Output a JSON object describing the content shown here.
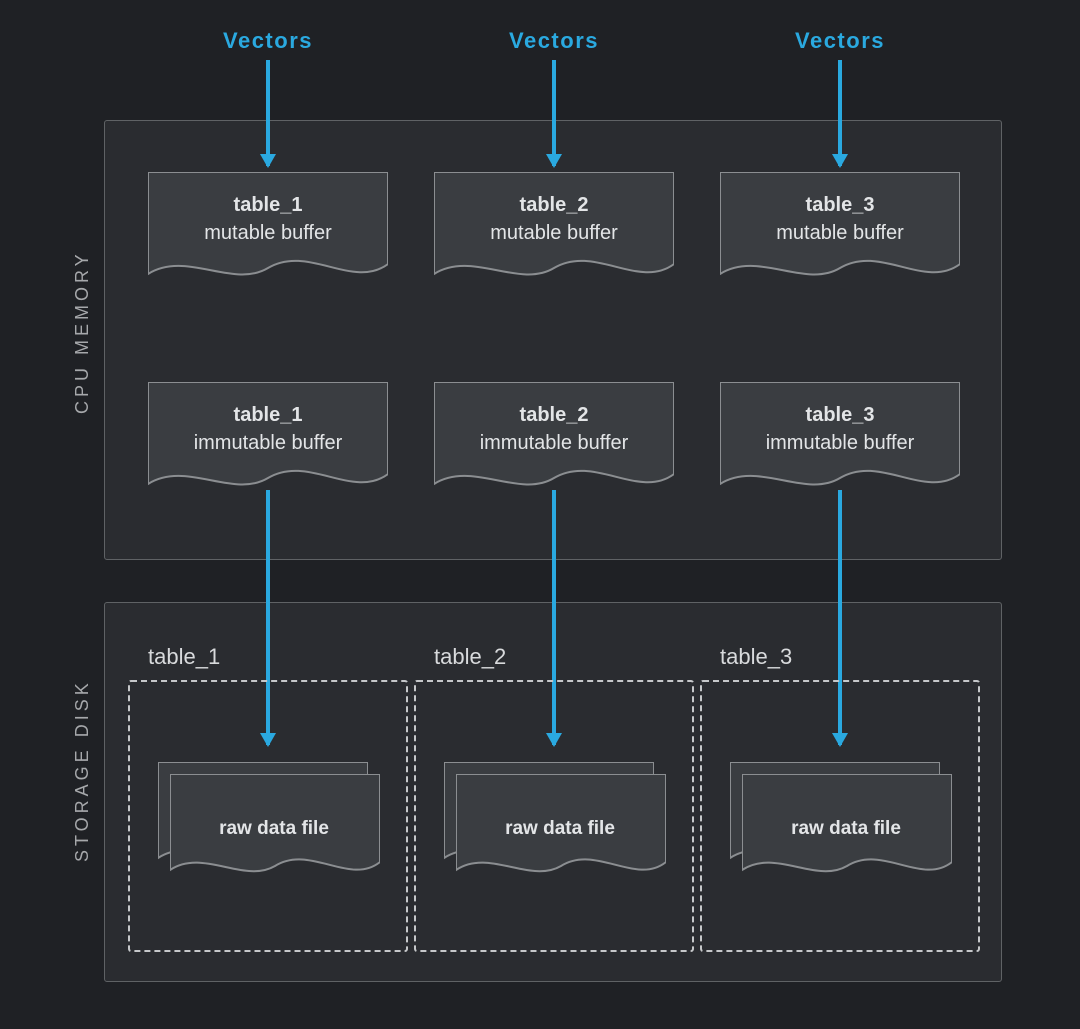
{
  "colors": {
    "accent": "#2aa9e0",
    "region_bg": "#2a2c30",
    "buffer_bg": "#3a3d41",
    "outline": "#8b8e91"
  },
  "header_labels": [
    "Vectors",
    "Vectors",
    "Vectors"
  ],
  "regions": {
    "memory": {
      "label": "CPU MEMORY"
    },
    "disk": {
      "label": "STORAGE DISK"
    }
  },
  "columns": [
    {
      "mutable": {
        "title": "table_1",
        "subtitle": "mutable buffer"
      },
      "immutable": {
        "title": "table_1",
        "subtitle": "immutable buffer"
      },
      "disk": {
        "title": "table_1",
        "file_label": "raw data file"
      }
    },
    {
      "mutable": {
        "title": "table_2",
        "subtitle": "mutable buffer"
      },
      "immutable": {
        "title": "table_2",
        "subtitle": "immutable buffer"
      },
      "disk": {
        "title": "table_2",
        "file_label": "raw data file"
      }
    },
    {
      "mutable": {
        "title": "table_3",
        "subtitle": "mutable buffer"
      },
      "immutable": {
        "title": "table_3",
        "subtitle": "immutable buffer"
      },
      "disk": {
        "title": "table_3",
        "file_label": "raw data file"
      }
    }
  ]
}
